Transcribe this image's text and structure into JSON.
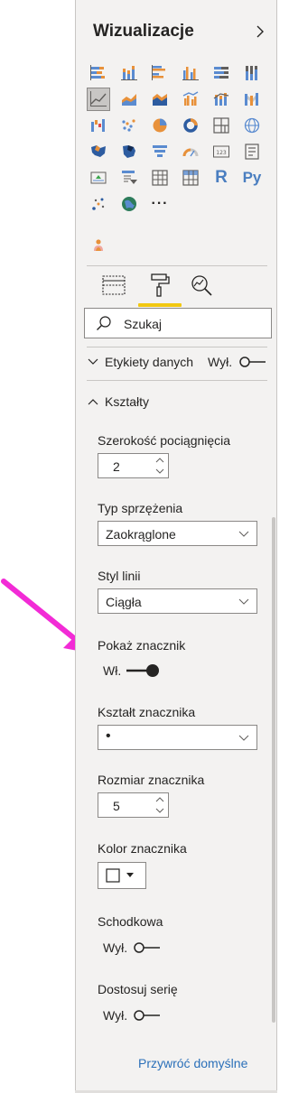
{
  "panel": {
    "title": "Wizualizacje",
    "expand_icon": "chevron-right-icon"
  },
  "visualizations": {
    "row6_r_label": "R",
    "row6_py_label": "Py",
    "more_label": "···",
    "selected": "line-chart",
    "icons": [
      "stacked-bar-chart-icon",
      "stacked-column-chart-icon",
      "clustered-bar-chart-icon",
      "clustered-column-chart-icon",
      "100-stacked-bar-chart-icon",
      "100-stacked-column-chart-icon",
      "line-chart-icon",
      "area-chart-icon",
      "stacked-area-chart-icon",
      "line-clustered-column-chart-icon",
      "line-stacked-column-chart-icon",
      "ribbon-chart-icon",
      "waterfall-chart-icon",
      "scatter-chart-icon",
      "pie-chart-icon",
      "donut-chart-icon",
      "treemap-icon",
      "map-icon",
      "filled-map-icon",
      "shape-map-icon",
      "funnel-icon",
      "gauge-icon",
      "card-icon",
      "multi-row-card-icon",
      "kpi-icon",
      "slicer-icon",
      "table-icon",
      "matrix-icon",
      "r-visual-icon",
      "python-visual-icon",
      "key-influencers-icon",
      "arcgis-map-icon",
      "more-visuals-icon"
    ]
  },
  "tabs": {
    "fields": "fields-tab-icon",
    "format": "paint-roller-icon",
    "analytics": "analytics-magnifier-icon",
    "active": "format"
  },
  "search": {
    "placeholder": "Szukaj"
  },
  "sections": {
    "data_labels": {
      "label": "Etykiety danych",
      "toggle_label": "Wył.",
      "state": "off"
    },
    "shapes": {
      "label": "Kształty",
      "stroke_width_label": "Szerokość pociągnięcia",
      "stroke_width_value": "2",
      "join_type_label": "Typ sprzężenia",
      "join_type_value": "Zaokrąglone",
      "line_style_label": "Styl linii",
      "line_style_value": "Ciągła",
      "show_marker_label": "Pokaż znacznik",
      "show_marker_toggle": "Wł.",
      "marker_shape_label": "Kształt znacznika",
      "marker_shape_value": "•",
      "marker_size_label": "Rozmiar znacznika",
      "marker_size_value": "5",
      "marker_color_label": "Kolor znacznika",
      "stepped_label": "Schodkowa",
      "stepped_toggle": "Wył.",
      "customize_series_label": "Dostosuj serię",
      "customize_series_toggle": "Wył."
    }
  },
  "footer": {
    "reset_label": "Przywróć domyślne"
  },
  "colors": {
    "accent_yellow": "#f2c811",
    "link_blue": "#2b70b9",
    "callout_arrow": "#f22bd6",
    "panel_bg": "#f3f2f1"
  }
}
